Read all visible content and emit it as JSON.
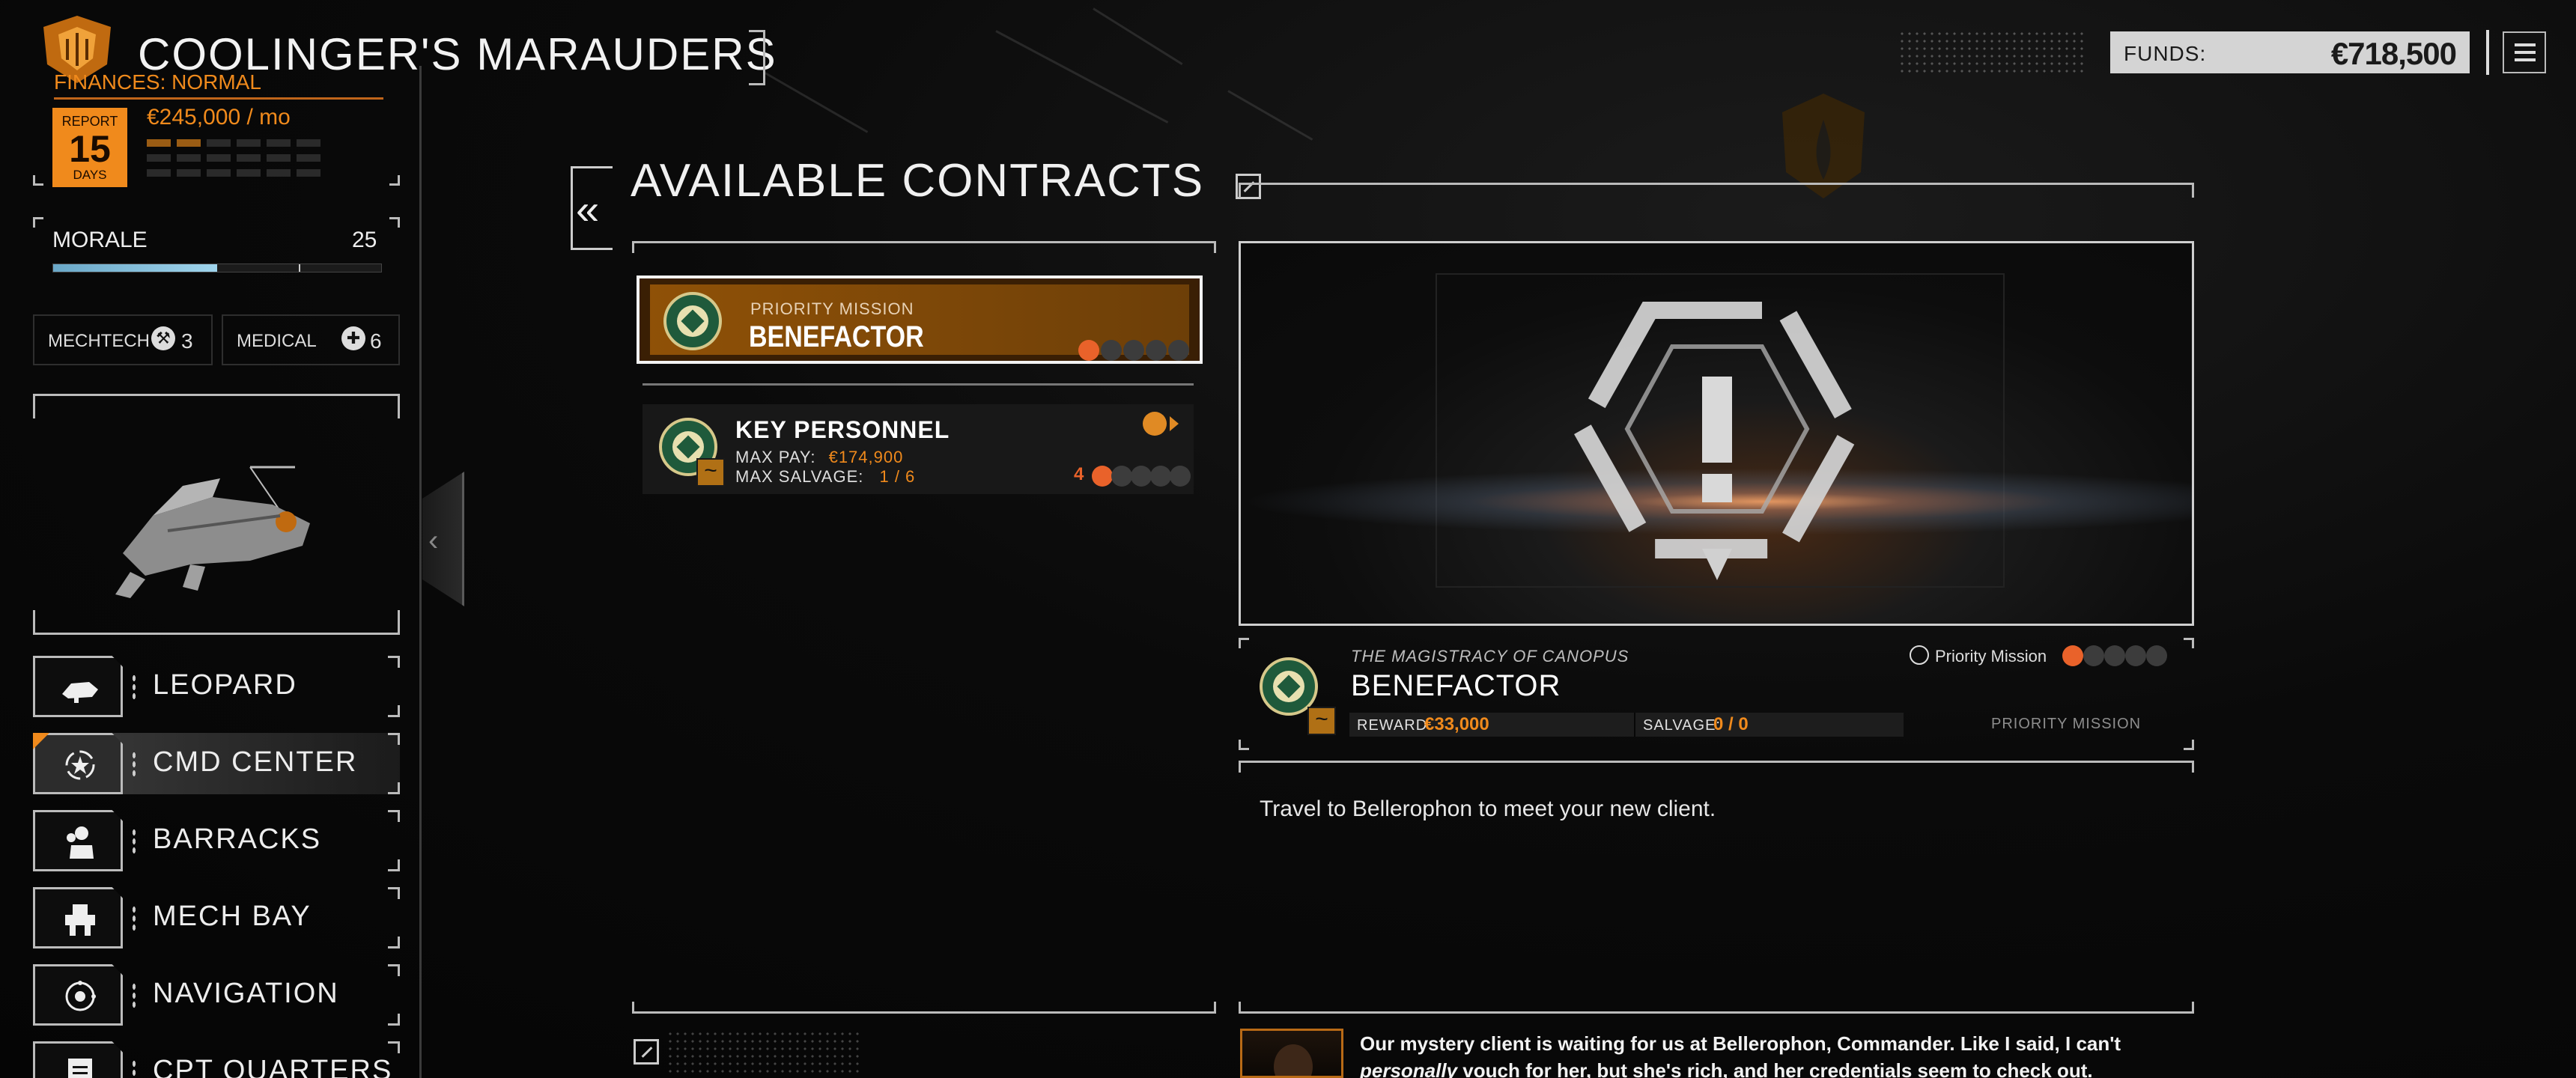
{
  "header": {
    "company_name": "COOLINGER'S MARAUDERS",
    "funds_label": "FUNDS:",
    "funds_value": "€718,500",
    "menu_icon": "hamburger-icon"
  },
  "finances": {
    "label": "FINANCES: NORMAL",
    "report_top": "REPORT",
    "report_days": "15",
    "report_bottom": "DAYS",
    "per_month": "€245,000 / mo",
    "bars_filled": 2,
    "bars_total": 18
  },
  "morale": {
    "label": "MORALE",
    "value": "25",
    "fill_fraction": 0.5
  },
  "stats": {
    "mechtech_label": "MECHTECH",
    "mechtech_value": "3",
    "medical_label": "MEDICAL",
    "medical_value": "6"
  },
  "nav": {
    "items": [
      {
        "label": "LEOPARD",
        "icon": "dropship-icon",
        "active": false
      },
      {
        "label": "CMD CENTER",
        "icon": "star-compass-icon",
        "active": true
      },
      {
        "label": "BARRACKS",
        "icon": "pilots-icon",
        "active": false
      },
      {
        "label": "MECH BAY",
        "icon": "mech-icon",
        "active": false
      },
      {
        "label": "NAVIGATION",
        "icon": "navigation-icon",
        "active": false
      },
      {
        "label": "CPT QUARTERS",
        "icon": "quarters-icon",
        "active": false
      }
    ]
  },
  "contracts": {
    "title": "AVAILABLE CONTRACTS",
    "back_label": "«",
    "list": [
      {
        "subtitle": "PRIORITY MISSION",
        "name": "BENEFACTOR",
        "difficulty": 1,
        "difficulty_max": 5,
        "selected": true
      },
      {
        "name": "KEY PERSONNEL",
        "pay_label": "MAX PAY:",
        "pay_value": "€174,900",
        "salvage_label": "MAX SALVAGE:",
        "salvage_value": "1 / 6",
        "tag_glyph": "~",
        "difficulty_label": "4",
        "difficulty": 1,
        "difficulty_max": 5,
        "selected": false
      }
    ]
  },
  "detail": {
    "faction": "THE MAGISTRACY OF CANOPUS",
    "name": "BENEFACTOR",
    "priority_label": "Priority Mission",
    "difficulty": 1,
    "difficulty_max": 5,
    "reward_label": "REWARD:",
    "reward_value": "€33,000",
    "salvage_label": "SALVAGE:",
    "salvage_value": "0 / 0",
    "tag": "PRIORITY MISSION",
    "tag_glyph": "~",
    "description": "Travel to Bellerophon to meet your new client.",
    "dialog_line1": "Our mystery client is waiting for us at Bellerophon, Commander. Like I said, I can't",
    "dialog_line2_em": "personally",
    "dialog_line2_rest": " vouch for her, but she's rich, and her credentials seem to check out."
  },
  "colors": {
    "accent_orange": "#f08a1c",
    "morale_blue": "#9fd4ec",
    "selected_bg": "#8f5107"
  }
}
